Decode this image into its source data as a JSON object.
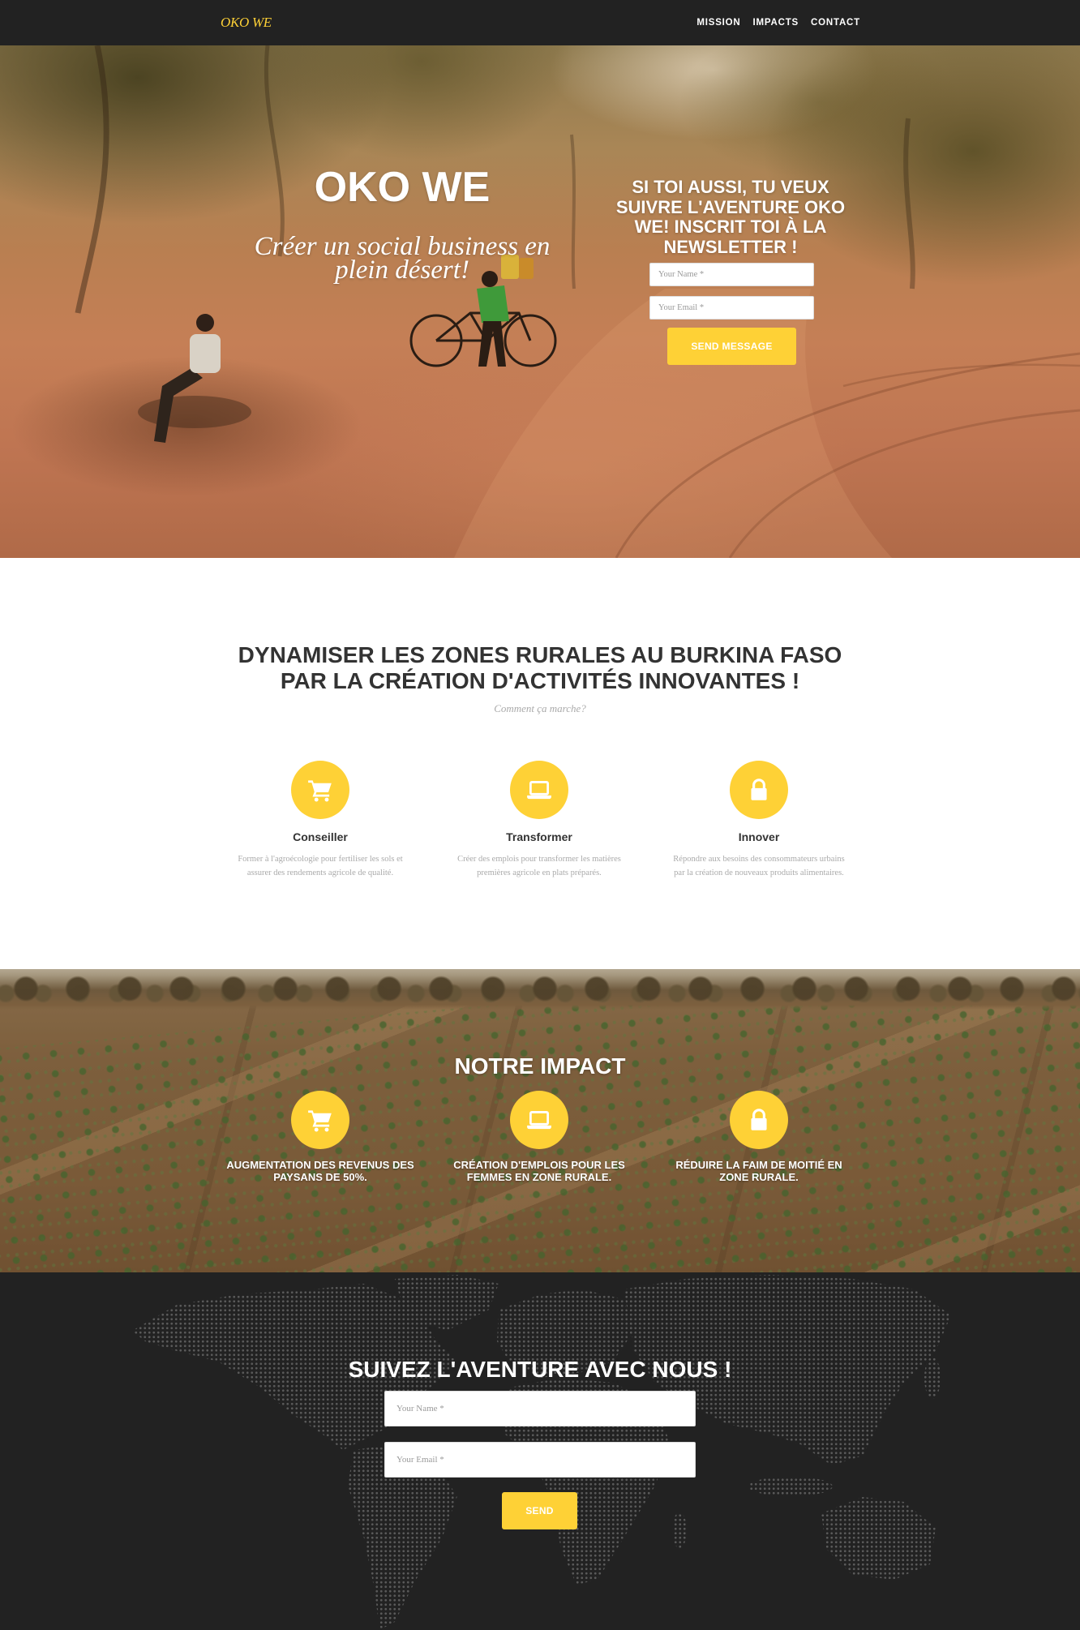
{
  "theme": {
    "accent": "#fed136",
    "dark": "#222222",
    "heading_text": "#333333",
    "muted_text": "#aaaaaa"
  },
  "navbar": {
    "brand": "OKO WE",
    "links": [
      "MISSION",
      "IMPACTS",
      "CONTACT"
    ]
  },
  "hero": {
    "title": "OKO WE",
    "tagline_lines": [
      "Créer un social business en",
      "plein désert!"
    ],
    "newsletter": {
      "heading_lines": [
        "SI TOI AUSSI, TU VEUX",
        "SUIVRE L'AVENTURE OKO",
        "WE! INSCRIT TOI À LA",
        "NEWSLETTER !"
      ],
      "name_placeholder": "Your Name *",
      "email_placeholder": "Your Email *",
      "submit_label": "SEND MESSAGE"
    }
  },
  "mission": {
    "heading_lines": [
      "DYNAMISER LES ZONES RURALES AU BURKINA FASO",
      "PAR LA CRÉATION D'ACTIVITÉS INNOVANTES !"
    ],
    "subheading": "Comment ça marche?",
    "features": [
      {
        "icon": "shopping-cart-icon",
        "title": "Conseiller",
        "description_lines": [
          "Former à l'agroécologie pour fertiliser les sols et",
          "assurer des rendements agricole de qualité."
        ]
      },
      {
        "icon": "laptop-icon",
        "title": "Transformer",
        "description_lines": [
          "Créer des emplois pour transformer les matières",
          "premières agricole en plats préparés."
        ]
      },
      {
        "icon": "lock-icon",
        "title": "Innover",
        "description_lines": [
          "Répondre aux besoins des consommateurs urbains",
          "par la création de nouveaux produits alimentaires."
        ]
      }
    ]
  },
  "impact": {
    "heading": "NOTRE IMPACT",
    "items": [
      {
        "icon": "shopping-cart-icon",
        "text_lines": [
          "AUGMENTATION DES REVENUS DES",
          "PAYSANS DE 50%."
        ]
      },
      {
        "icon": "laptop-icon",
        "text_lines": [
          "CRÉATION D'EMPLOIS POUR LES",
          "FEMMES EN ZONE RURALE."
        ]
      },
      {
        "icon": "lock-icon",
        "text_lines": [
          "RÉDUIRE LA FAIM DE MOITIÉ EN",
          "ZONE RURALE."
        ]
      }
    ]
  },
  "contact": {
    "heading": "SUIVEZ L'AVENTURE AVEC NOUS !",
    "name_placeholder": "Your Name *",
    "email_placeholder": "Your Email *",
    "submit_label": "SEND"
  }
}
